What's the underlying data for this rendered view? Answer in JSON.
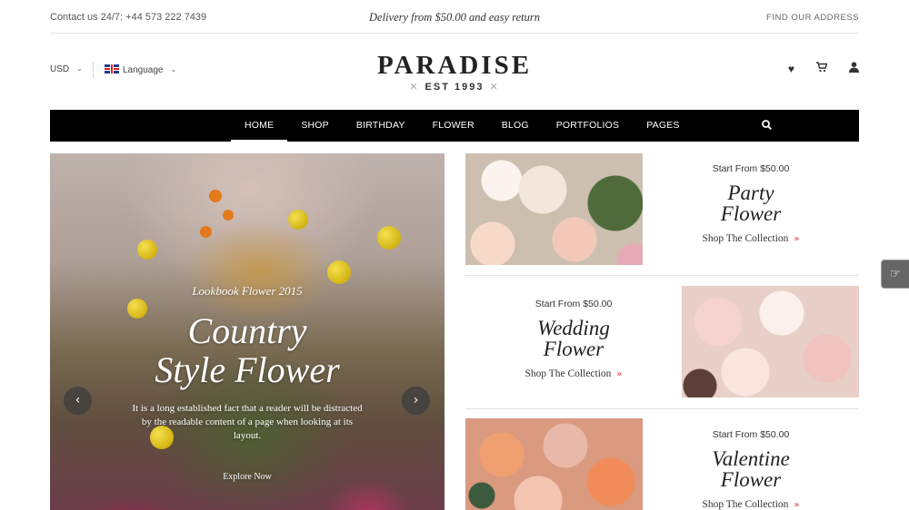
{
  "topbar": {
    "contact": "Contact us 24/7: +44 573 222 7439",
    "delivery": "Delivery from $50.00 and easy return",
    "find_address": "FIND OUR ADDRESS"
  },
  "header": {
    "currency": "USD",
    "language": "Language",
    "logo_name": "PARADISE",
    "logo_est": "EST 1993",
    "icons": [
      "heart-icon",
      "cart-icon",
      "user-icon"
    ]
  },
  "nav": {
    "items": [
      "HOME",
      "SHOP",
      "BIRTHDAY",
      "FLOWER",
      "BLOG",
      "PORTFOLIOS",
      "PAGES"
    ],
    "active": "HOME"
  },
  "hero": {
    "kicker": "Lookbook Flower 2015",
    "title_line1": "Country",
    "title_line2": "Style Flower",
    "description": "It is a long established fact that a reader will be distracted by the readable content of a page when looking at its layout.",
    "cta": "Explore Now"
  },
  "collections": [
    {
      "price": "Start From $50.00",
      "title_line1": "Party",
      "title_line2": "Flower",
      "link": "Shop The Collection"
    },
    {
      "price": "Start From $50.00",
      "title_line1": "Wedding",
      "title_line2": "Flower",
      "link": "Shop The Collection"
    },
    {
      "price": "Start From $50.00",
      "title_line1": "Valentine",
      "title_line2": "Flower",
      "link": "Shop The Collection"
    }
  ],
  "colors": {
    "nav_bg": "#000000",
    "accent_chevron": "#d9363e"
  }
}
